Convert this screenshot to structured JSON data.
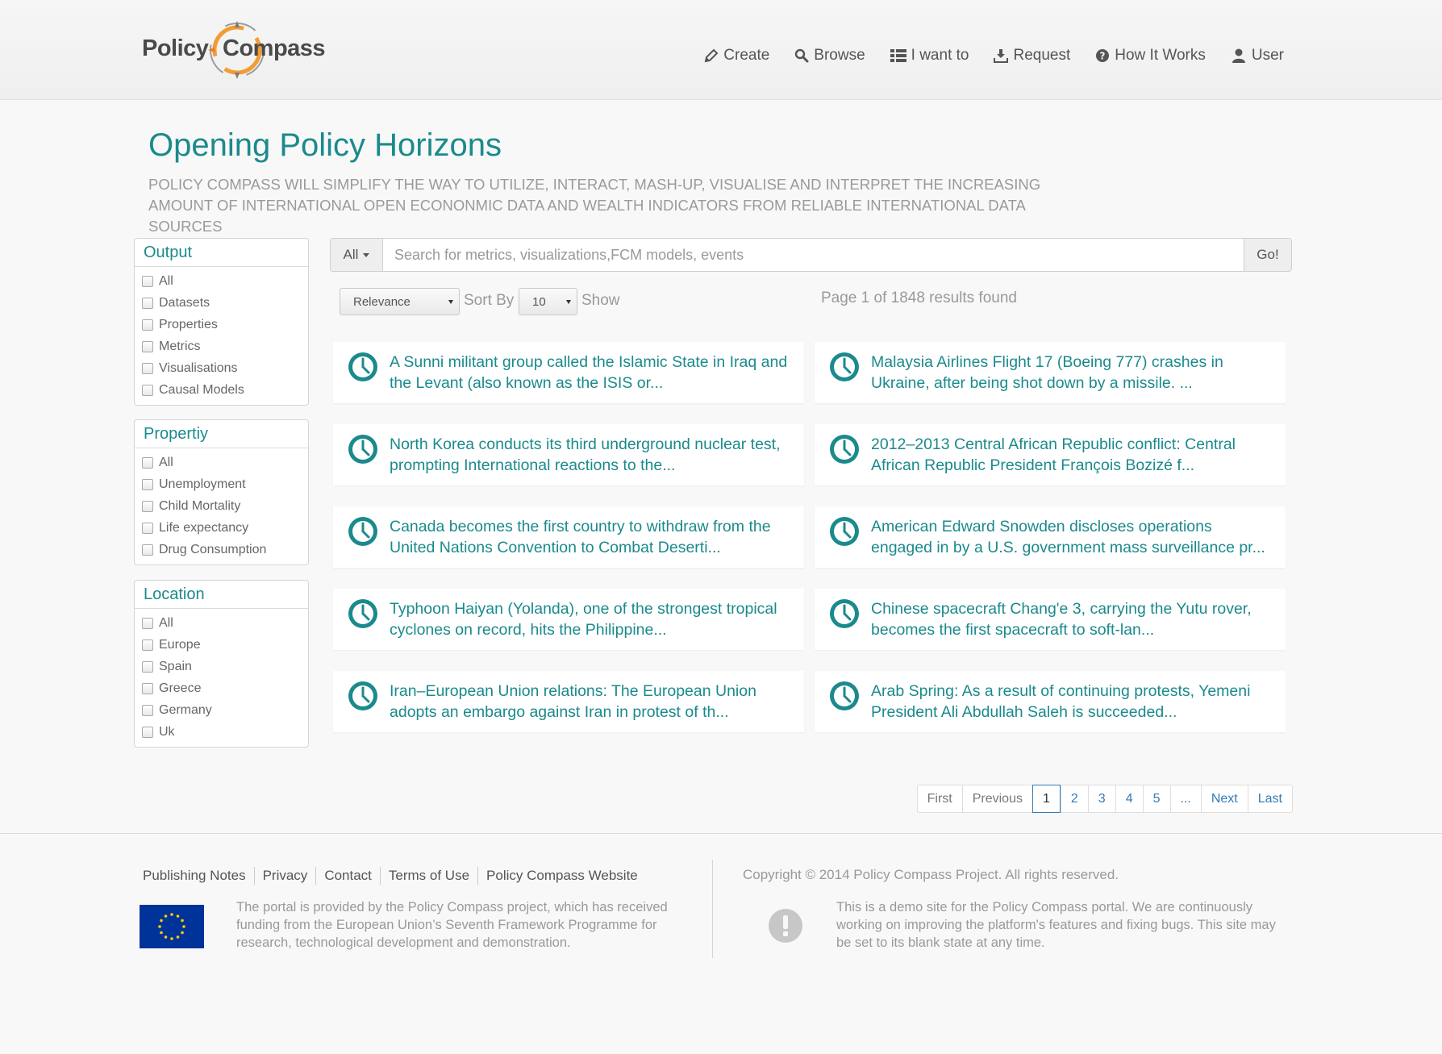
{
  "brand": {
    "logo_word1": "Policy",
    "logo_word2": "Compass",
    "accent_color": "#1b8a8c"
  },
  "nav": {
    "items": [
      {
        "label": "Create",
        "icon": "pencil-icon"
      },
      {
        "label": "Browse",
        "icon": "search-icon"
      },
      {
        "label": "I want to",
        "icon": "list-icon"
      },
      {
        "label": "Request",
        "icon": "download-icon"
      },
      {
        "label": "How It Works",
        "icon": "question-icon"
      },
      {
        "label": "User",
        "icon": "user-icon"
      }
    ]
  },
  "hero": {
    "title": "Opening Policy Horizons",
    "subtitle": "Policy Compass will simplify the way to utilize, interact, mash-up, visualise and interpret the increasing amount of international open econonmic data and wealth indicators from reliable international data sources"
  },
  "filters": {
    "output": {
      "title": "Output",
      "options": [
        "All",
        "Datasets",
        "Properties",
        "Metrics",
        "Visualisations",
        "Causal Models"
      ]
    },
    "property": {
      "title": "Propertiy",
      "options": [
        "All",
        "Unemployment",
        "Child Mortality",
        "Life expectancy",
        "Drug Consumption"
      ]
    },
    "location": {
      "title": "Location",
      "options": [
        "All",
        "Europe",
        "Spain",
        "Greece",
        "Germany",
        "Uk"
      ]
    }
  },
  "search": {
    "scope_label": "All",
    "placeholder": "Search for metrics, visualizations,FCM models, events",
    "value": "",
    "go_label": "Go!"
  },
  "sort": {
    "relevance_value": "Relevance",
    "sort_by_label": "Sort By",
    "count_value": "10",
    "show_label": "Show",
    "results_text": "Page 1 of 1848 results found"
  },
  "results": [
    {
      "text": "A Sunni militant group called the Islamic State in Iraq and the Levant (also known as the ISIS or...",
      "icon": "clock-icon"
    },
    {
      "text": "Malaysia Airlines Flight 17 (Boeing 777) crashes in Ukraine, after being shot down by a missile. ...",
      "icon": "clock-icon"
    },
    {
      "text": "North Korea conducts its third underground nuclear test, prompting International reactions to the...",
      "icon": "clock-icon"
    },
    {
      "text": "2012–2013 Central African Republic conflict: Central African Republic President François Bozizé f...",
      "icon": "clock-icon"
    },
    {
      "text": "Canada becomes the first country to withdraw from the United Nations Convention to Combat Deserti...",
      "icon": "clock-icon"
    },
    {
      "text": "American Edward Snowden discloses operations engaged in by a U.S. government mass surveillance pr...",
      "icon": "clock-icon"
    },
    {
      "text": "Typhoon Haiyan (Yolanda), one of the strongest tropical cyclones on record, hits the Philippine...",
      "icon": "clock-icon"
    },
    {
      "text": "Chinese spacecraft Chang'e 3, carrying the Yutu rover, becomes the first spacecraft to soft-lan...",
      "icon": "clock-icon"
    },
    {
      "text": "Iran–European Union relations: The European Union adopts an embargo against Iran in protest of th...",
      "icon": "clock-icon"
    },
    {
      "text": "Arab Spring: As a result of continuing protests, Yemeni President Ali Abdullah Saleh is succeeded...",
      "icon": "clock-icon"
    }
  ],
  "pagination": {
    "items": [
      "First",
      "Previous",
      "1",
      "2",
      "3",
      "4",
      "5",
      "...",
      "Next",
      "Last"
    ],
    "current": "1"
  },
  "footer": {
    "links": [
      "Publishing Notes",
      "Privacy",
      "Contact",
      "Terms of Use",
      "Policy Compass Website"
    ],
    "about": "The portal is provided by the Policy Compass project, which has received funding from the European Union’s Seventh Framework Programme for research, technological development and demonstration.",
    "copyright": "Copyright © 2014 Policy Compass Project. All rights reserved.",
    "demo_notice": "This is a demo site for the Policy Compass portal. We are continuously working on improving the platform's features and fixing bugs. This site may be set to its blank state at any time."
  }
}
